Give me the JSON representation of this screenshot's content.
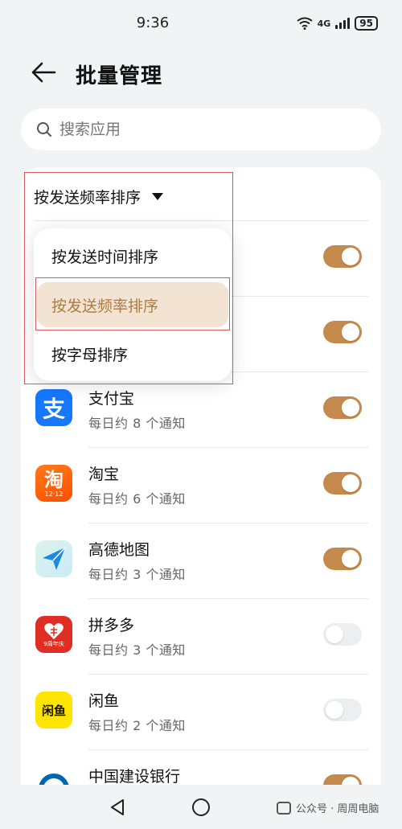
{
  "status_bar": {
    "time": "9:36",
    "network": "4G",
    "battery": "95"
  },
  "header": {
    "title": "批量管理"
  },
  "search": {
    "placeholder": "搜索应用"
  },
  "sort": {
    "current": "按发送频率排序",
    "options": [
      "按发送时间排序",
      "按发送频率排序",
      "按字母排序"
    ],
    "selected_index": 1
  },
  "apps": [
    {
      "name": "",
      "sub": "",
      "enabled": true
    },
    {
      "name": "",
      "sub": "",
      "enabled": true
    },
    {
      "name": "支付宝",
      "sub": "每日约 8 个通知",
      "enabled": true,
      "icon": "alipay-icon",
      "icon_text": "支",
      "color": "#1677ff"
    },
    {
      "name": "淘宝",
      "sub": "每日约 6 个通知",
      "enabled": true,
      "icon": "taobao-icon",
      "icon_text": "淘",
      "icon_badge": "12·12",
      "color": "#ff5000"
    },
    {
      "name": "高德地图",
      "sub": "每日约 3 个通知",
      "enabled": true,
      "icon": "amap-icon",
      "color": "#1e88e5"
    },
    {
      "name": "拼多多",
      "sub": "每日约 3 个通知",
      "enabled": false,
      "icon": "pinduoduo-icon",
      "icon_badge": "9周年庆",
      "color": "#e02e24"
    },
    {
      "name": "闲鱼",
      "sub": "每日约 2 个通知",
      "enabled": false,
      "icon": "xianyu-icon",
      "icon_text": "闲鱼",
      "color": "#ffe400"
    },
    {
      "name": "中国建设银行",
      "sub": "",
      "enabled": true,
      "icon": "ccb-icon",
      "color": "#0066b3"
    }
  ],
  "colors": {
    "toggle_on": "#c48a4d",
    "toggle_off": "#eceef0",
    "selected_bg": "#f2e3d2",
    "selected_text": "#b07a3e",
    "annotation": "#d25a5a"
  },
  "watermark": {
    "text": "公众号 · 周周电脑"
  }
}
